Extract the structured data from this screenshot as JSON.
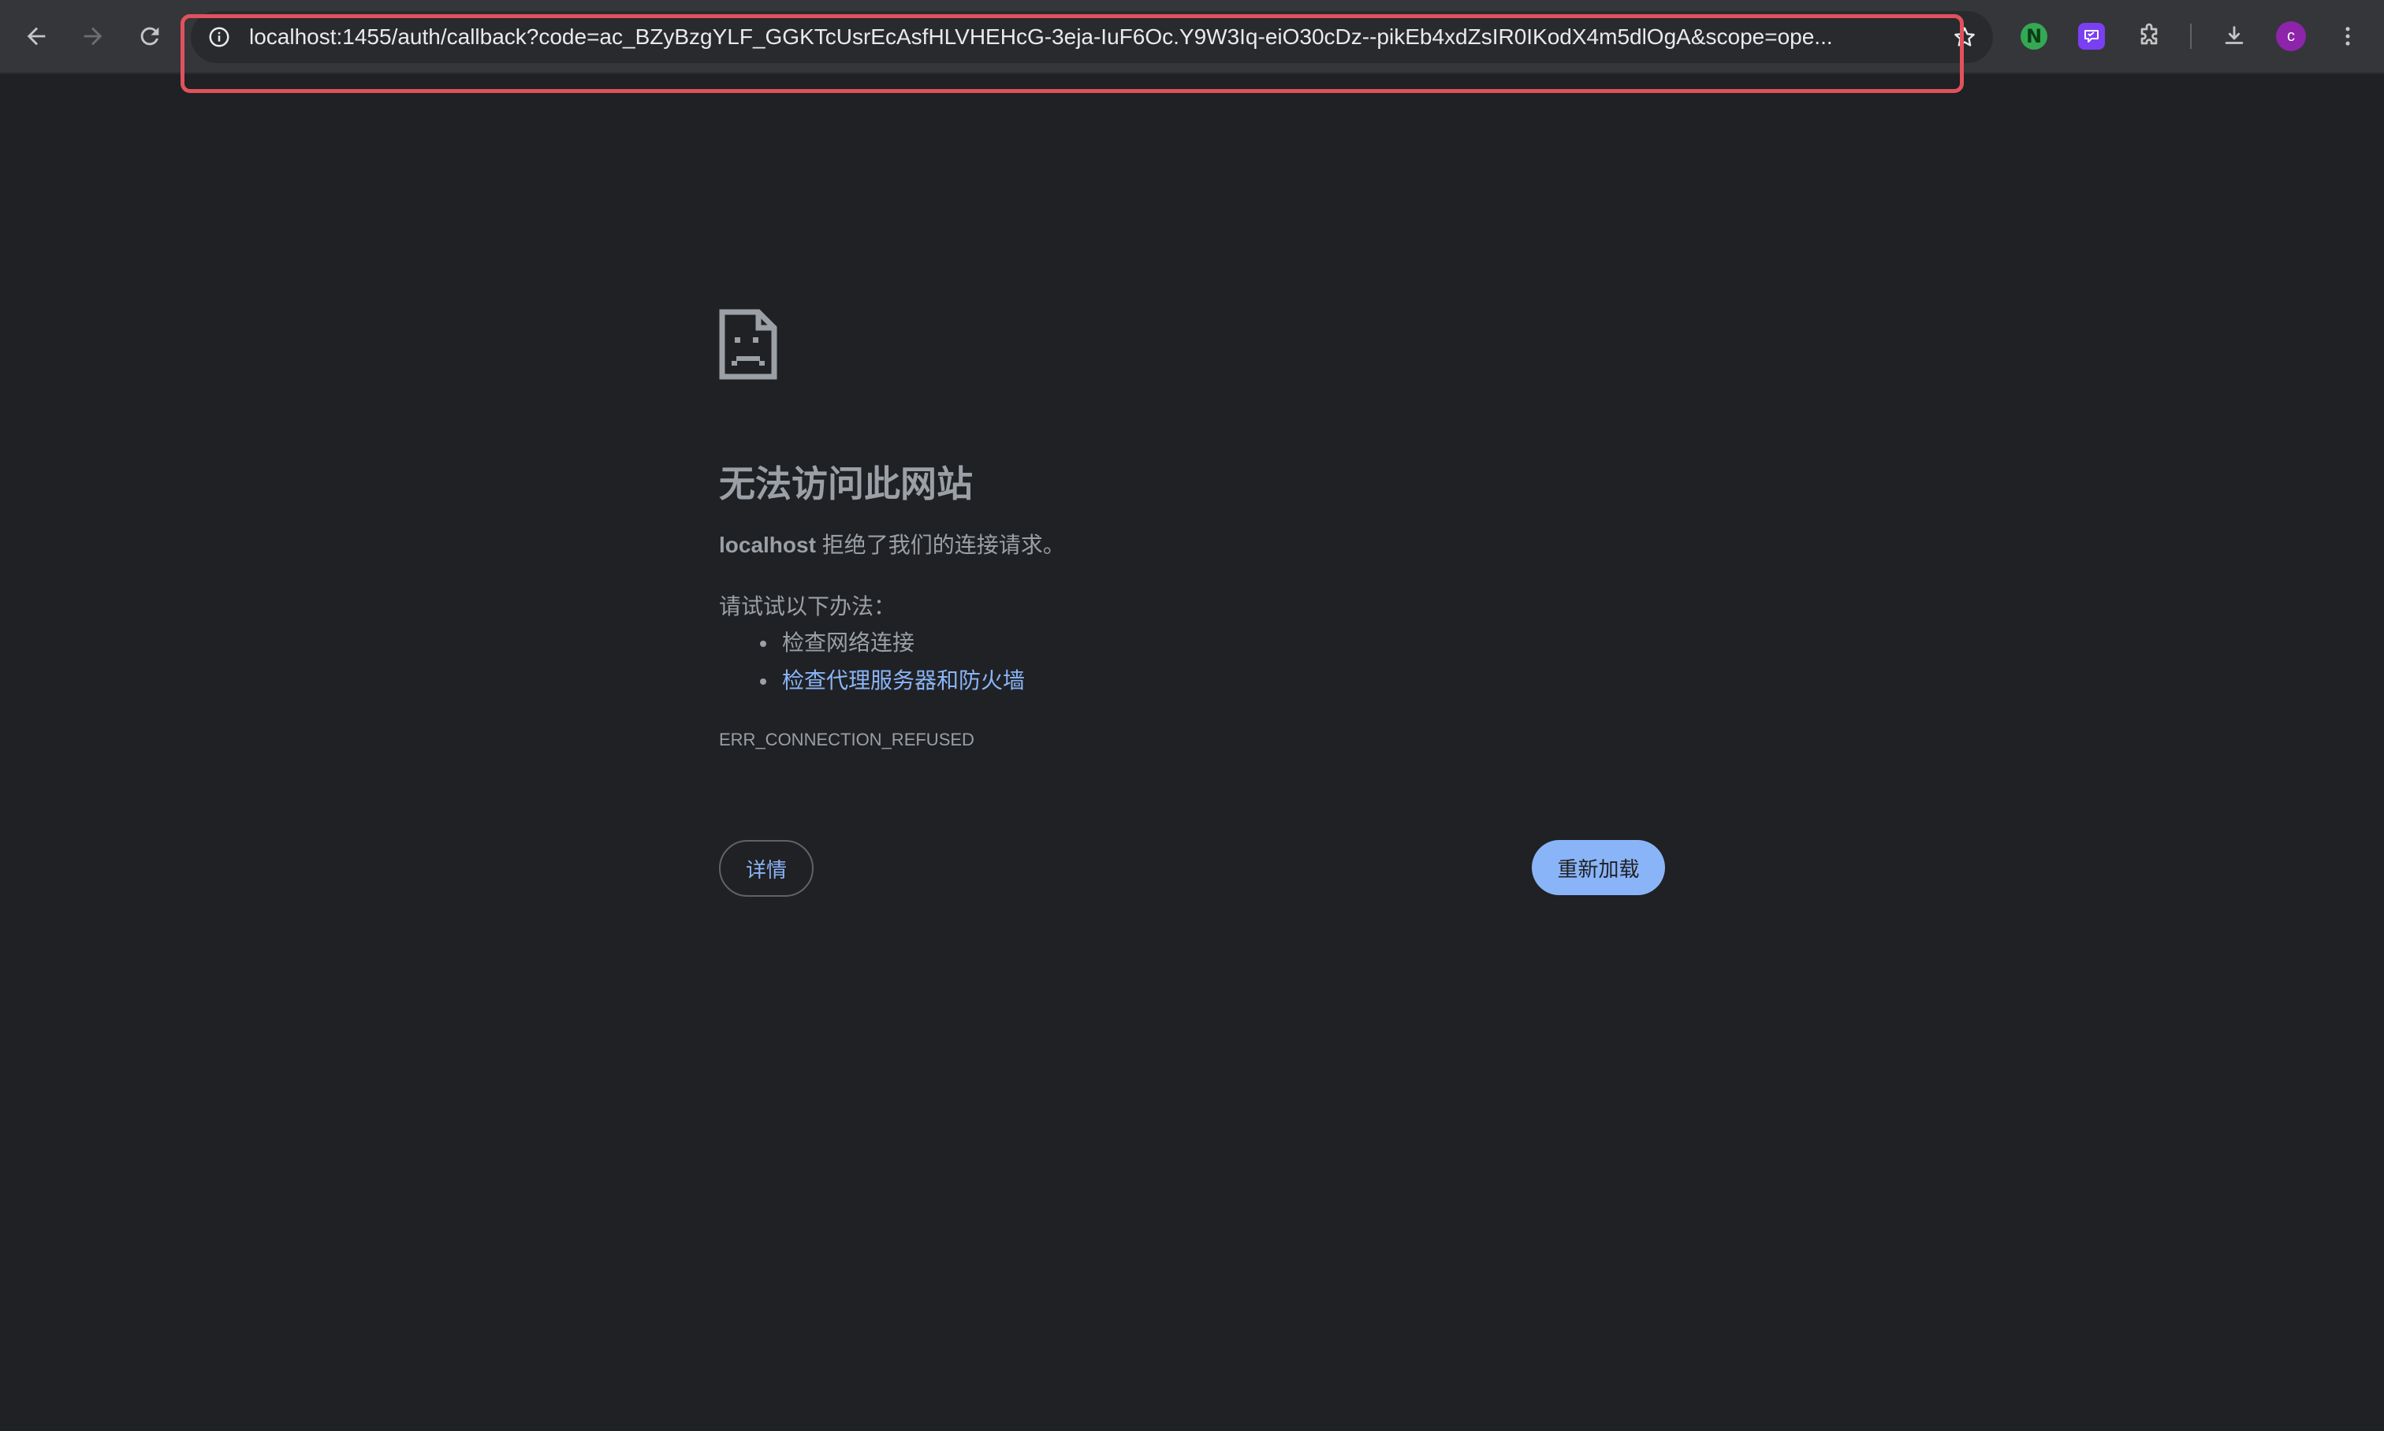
{
  "browser": {
    "url": "localhost:1455/auth/callback?code=ac_BZyBzgYLF_GGKTcUsrEcAsfHLVHEHcG-3eja-IuF6Oc.Y9W3Iq-eiO30cDz--pikEb4xdZsIR0IKodX4m5dlOgA&scope=ope...",
    "avatar_letter": "c",
    "extensions": [
      {
        "name": "n-extension-icon",
        "letter": "N",
        "color": "#34a853"
      },
      {
        "name": "purple-extension-icon",
        "color": "#7b3ff2"
      }
    ],
    "highlight_color": "#e0525c"
  },
  "error_page": {
    "title": "无法访问此网站",
    "host": "localhost",
    "description_suffix": " 拒绝了我们的连接请求。",
    "try_label": "请试试以下办法：",
    "suggestions": [
      {
        "text": "检查网络连接",
        "is_link": false
      },
      {
        "text": "检查代理服务器和防火墙",
        "is_link": true
      }
    ],
    "error_code": "ERR_CONNECTION_REFUSED",
    "details_button": "详情",
    "reload_button": "重新加载"
  },
  "theme": {
    "background": "#202124",
    "toolbar": "#35363a",
    "text_muted": "#9aa0a6",
    "link": "#8ab4f8"
  }
}
